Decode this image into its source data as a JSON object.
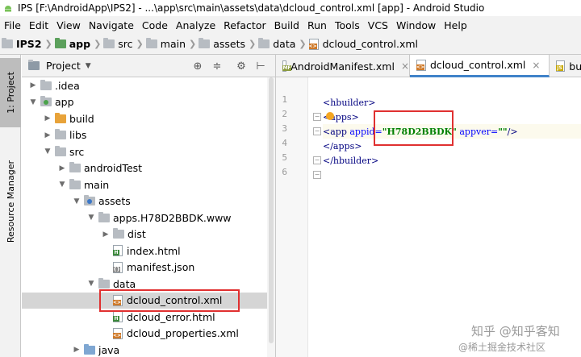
{
  "title": "IPS [F:\\AndroidApp\\IPS2] - ...\\app\\src\\main\\assets\\data\\dcloud_control.xml [app] - Android Studio",
  "menu": [
    "File",
    "Edit",
    "View",
    "Navigate",
    "Code",
    "Analyze",
    "Refactor",
    "Build",
    "Run",
    "Tools",
    "VCS",
    "Window",
    "Help"
  ],
  "breadcrumbs": [
    "IPS2",
    "app",
    "src",
    "main",
    "assets",
    "data",
    "dcloud_control.xml"
  ],
  "side_tabs": {
    "project": "1: Project",
    "resource_manager": "Resource Manager"
  },
  "project_panel": {
    "title": "Project",
    "icons": [
      "target-icon",
      "collapse-icon",
      "gear-icon",
      "hide-icon"
    ]
  },
  "tree": [
    {
      "label": ".idea",
      "indent": 1,
      "arrow": "right",
      "icon": "folder"
    },
    {
      "label": "app",
      "indent": 1,
      "arrow": "down",
      "icon": "folder-module"
    },
    {
      "label": "build",
      "indent": 2,
      "arrow": "right",
      "icon": "folder-orange"
    },
    {
      "label": "libs",
      "indent": 2,
      "arrow": "right",
      "icon": "folder"
    },
    {
      "label": "src",
      "indent": 2,
      "arrow": "down",
      "icon": "folder"
    },
    {
      "label": "androidTest",
      "indent": 3,
      "arrow": "right",
      "icon": "folder"
    },
    {
      "label": "main",
      "indent": 3,
      "arrow": "down",
      "icon": "folder"
    },
    {
      "label": "assets",
      "indent": 4,
      "arrow": "down",
      "icon": "folder-res"
    },
    {
      "label": "apps.H78D2BBDK.www",
      "indent": 5,
      "arrow": "down",
      "icon": "folder"
    },
    {
      "label": "dist",
      "indent": 6,
      "arrow": "right",
      "icon": "folder"
    },
    {
      "label": "index.html",
      "indent": 6,
      "arrow": "",
      "icon": "html"
    },
    {
      "label": "manifest.json",
      "indent": 6,
      "arrow": "",
      "icon": "json"
    },
    {
      "label": "data",
      "indent": 5,
      "arrow": "down",
      "icon": "folder"
    },
    {
      "label": "dcloud_control.xml",
      "indent": 6,
      "arrow": "",
      "icon": "xml",
      "selected": true
    },
    {
      "label": "dcloud_error.html",
      "indent": 6,
      "arrow": "",
      "icon": "html"
    },
    {
      "label": "dcloud_properties.xml",
      "indent": 6,
      "arrow": "",
      "icon": "xml"
    },
    {
      "label": "java",
      "indent": 4,
      "arrow": "right",
      "icon": "folder-blue"
    }
  ],
  "editor_tabs": [
    {
      "label": "AndroidManifest.xml",
      "icon": "mf",
      "active": false
    },
    {
      "label": "dcloud_control.xml",
      "icon": "xml",
      "active": true
    },
    {
      "label": "build.",
      "icon": "js",
      "active": false
    }
  ],
  "code": {
    "line_numbers": [
      "1",
      "2",
      "3",
      "4",
      "5",
      "6"
    ],
    "l2_tag": "<hbuilder>",
    "l3_tag": "<apps>",
    "l4_open": "<app ",
    "l4_attr1": "appid=",
    "l4_val1": "\"H78D2BBDK\"",
    "l4_attr2": " appver=",
    "l4_val2": "\"\"",
    "l4_close": "/>",
    "l5_tag": "</apps>",
    "l6_tag": "</hbuilder>"
  },
  "watermark": {
    "line1": "知乎 @知乎客知",
    "line2": "@稀土掘金技术社区"
  },
  "colors": {
    "highlight_box": "#e03030",
    "tab_underline": "#4083c9",
    "xml_tag": "#000080",
    "xml_attr": "#0000ff",
    "xml_value": "#008000"
  }
}
